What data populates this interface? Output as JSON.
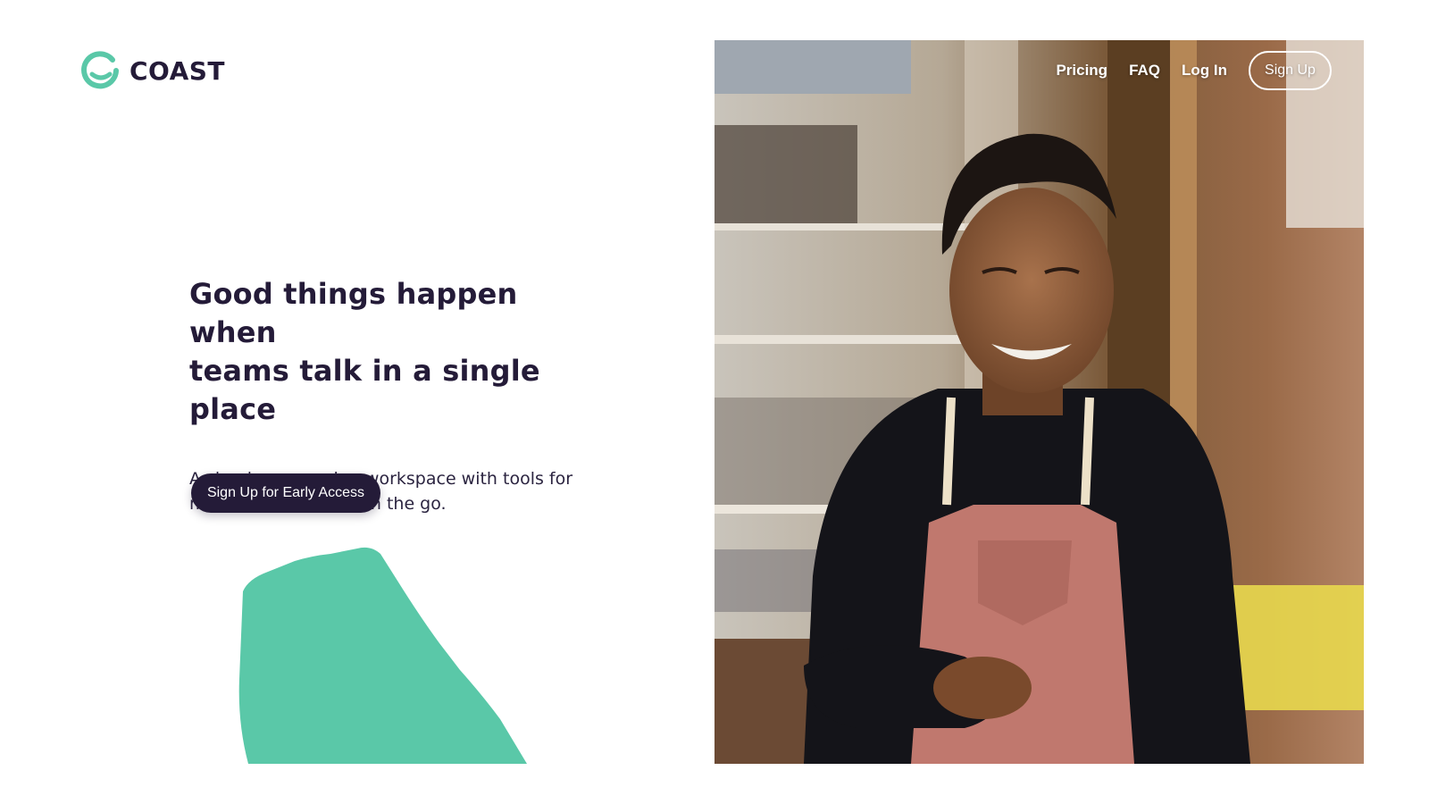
{
  "brand": {
    "name": "COAST",
    "accent_color": "#5ac8a8",
    "dark_color": "#241b38"
  },
  "nav": {
    "links": [
      "Pricing",
      "FAQ",
      "Log In"
    ],
    "signup_label": "Sign Up"
  },
  "hero": {
    "title_line_1": "Good things happen when",
    "title_line_2": "teams talk in a single place",
    "subtitle_line_1": "A simple messaging workspace with tools for",
    "subtitle_line_2": "managers and staff on the go.",
    "cta_label": "Sign Up for Early Access"
  },
  "media": {
    "hero_photo": "photo-icon",
    "decorative_shape": "brush-shape-icon"
  }
}
